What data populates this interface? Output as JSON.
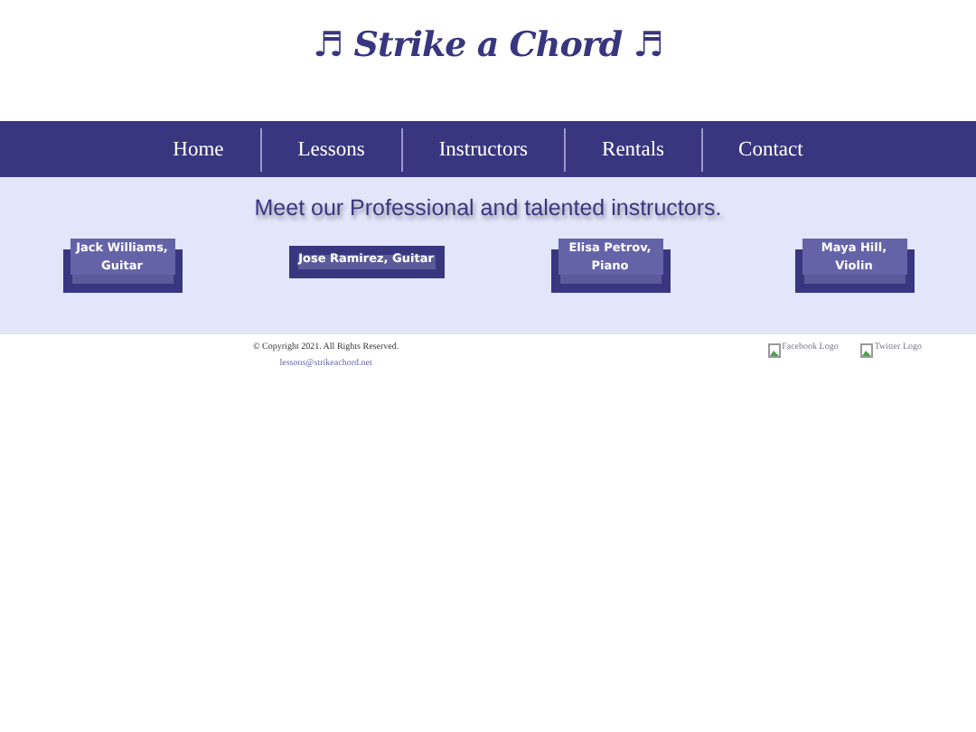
{
  "header": {
    "title": "♬ Strike a Chord ♬"
  },
  "nav": [
    {
      "label": "Home"
    },
    {
      "label": "Lessons"
    },
    {
      "label": "Instructors"
    },
    {
      "label": "Rentals"
    },
    {
      "label": "Contact"
    }
  ],
  "intro": "Meet our Professional and talented instructors.",
  "instructors": [
    {
      "name": "Jack Williams, Guitar",
      "wide": false
    },
    {
      "name": "Jose Ramirez, Guitar",
      "wide": true
    },
    {
      "name": "Elisa Petrov, Piano",
      "wide": false
    },
    {
      "name": "Maya Hill, Violin",
      "wide": false
    }
  ],
  "footer": {
    "copyright": "© Copyright 2021. All Rights Reserved.",
    "email": "lessons@strikeachord.net",
    "social": [
      {
        "alt": "Facebook Logo"
      },
      {
        "alt": "Twitter Logo"
      }
    ]
  }
}
